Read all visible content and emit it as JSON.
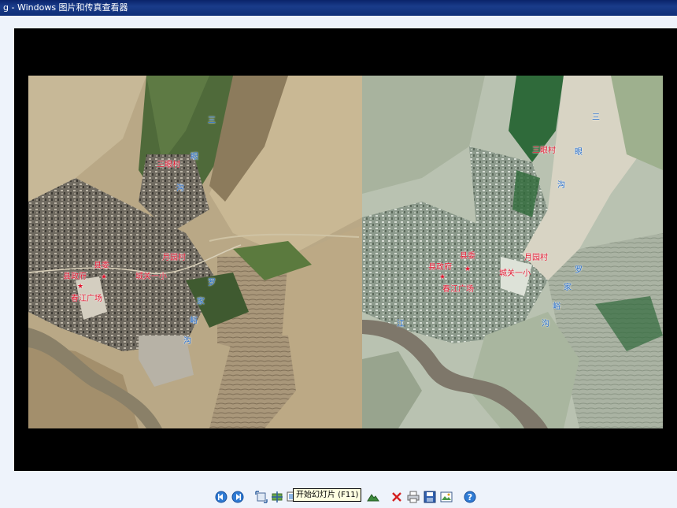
{
  "window": {
    "title": "g - Windows 图片和传真查看器"
  },
  "map_labels": {
    "left": {
      "san": "三",
      "sanyancun": "三眼村",
      "yan": "眼",
      "gou": "沟",
      "yueyuancun": "月园村",
      "xianwei": "县委",
      "xianzhengfu": "县政府",
      "chengguanyixiao": "城关一小",
      "chunjiangguangchang": "春江广场",
      "luo": "罗",
      "jia": "家",
      "yu": "峪",
      "gou2": "沟"
    },
    "right": {
      "san": "三",
      "sanyancun": "三眼村",
      "yan": "眼",
      "gou": "沟",
      "yueyuancun": "月园村",
      "xianwei": "县委",
      "xianzhengfu": "县政府",
      "chengguanyixiao": "城关一小",
      "chunjiangguangchang": "春江广场",
      "luo": "罗",
      "jia": "家",
      "yu": "峪",
      "gou2": "沟",
      "jiang": "江"
    }
  },
  "toolbar": {
    "buttons": [
      "previous-image-icon",
      "next-image-icon",
      "best-fit-icon",
      "actual-size-icon",
      "slideshow-icon",
      "zoom-in-icon",
      "zoom-out-icon",
      "rotate-clockwise-icon",
      "rotate-counterclockwise-icon",
      "delete-icon",
      "print-icon",
      "save-icon",
      "edit-icon",
      "help-icon"
    ],
    "tooltip": "开始幻灯片 (F11)"
  },
  "colors": {
    "viewer_bg": "#000000",
    "window_bg": "#eef3fb",
    "label_red": "#e0142c",
    "label_blue": "#1e68c8"
  }
}
